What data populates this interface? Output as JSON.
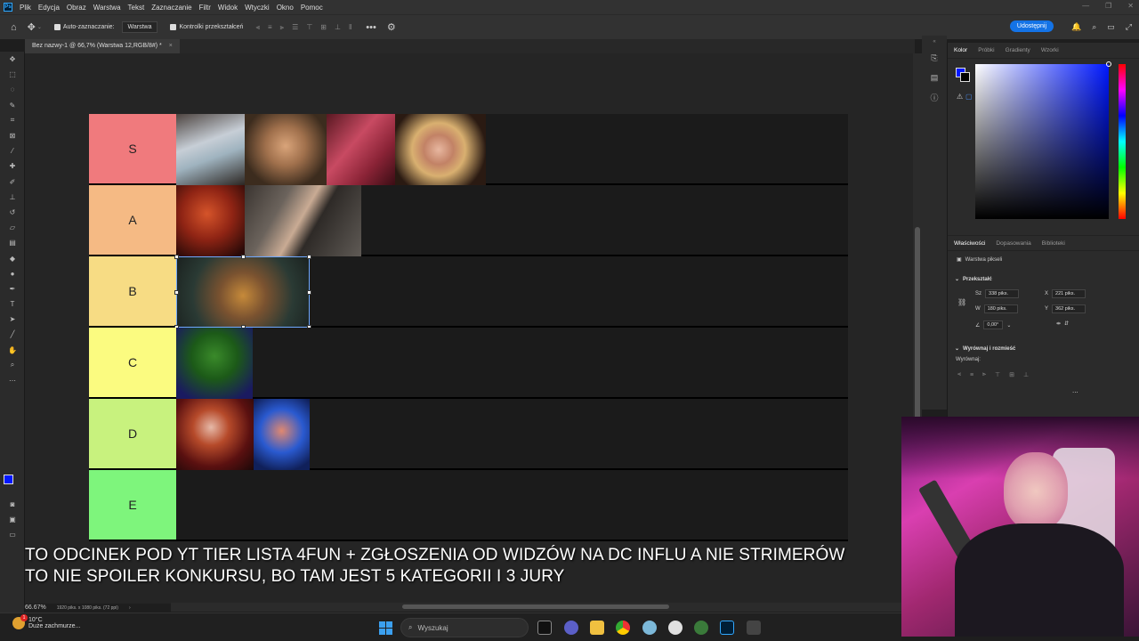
{
  "app": {
    "logo": "Ps"
  },
  "menu": [
    "Plik",
    "Edycja",
    "Obraz",
    "Warstwa",
    "Tekst",
    "Zaznaczanie",
    "Filtr",
    "Widok",
    "Wtyczki",
    "Okno",
    "Pomoc"
  ],
  "options": {
    "auto_select_label": "Auto-zaznaczanie:",
    "auto_select_value": "Warstwa",
    "transform_controls_label": "Kontrolki przekształceń",
    "share_label": "Udostępnij"
  },
  "doc_tab": {
    "title": "Bez nazwy-1 @ 66,7% (Warstwa 12,RGB/8#) *",
    "close": "×"
  },
  "tier_list": {
    "tiers": [
      {
        "label": "S",
        "color": "#f07a7d"
      },
      {
        "label": "A",
        "color": "#f5ba84"
      },
      {
        "label": "B",
        "color": "#f7dc84"
      },
      {
        "label": "C",
        "color": "#fbfb80"
      },
      {
        "label": "D",
        "color": "#c8f27e"
      },
      {
        "label": "E",
        "color": "#7ef57c"
      }
    ]
  },
  "status": {
    "zoom": "66.67%",
    "doc_size": "1920 piks. x 1080 piks. (72 ppi)",
    "arrow": "›"
  },
  "color_panel": {
    "tabs": [
      "Kolor",
      "Próbki",
      "Gradienty",
      "Wzorki"
    ],
    "foreground": "#0018ff",
    "background": "#000000"
  },
  "properties": {
    "tabs": [
      "Właściwości",
      "Dopasowania",
      "Biblioteki"
    ],
    "layer_type": "Warstwa pikseli",
    "transform_title": "Przekształć",
    "w_label": "Sz",
    "w_value": "338 piks.",
    "h_label": "W",
    "h_value": "180 piks.",
    "x_label": "X",
    "x_value": "221 piks.",
    "y_label": "Y",
    "y_value": "362 piks.",
    "angle_value": "0,00°",
    "align_title": "Wyrównaj i rozmieść",
    "align_label": "Wyrównaj:",
    "more": "..."
  },
  "subtitle": {
    "line1": "TO ODCINEK POD YT TIER LISTA 4FUN + ZGŁOSZENIA OD WIDZÓW NA DC INFLU A NIE STRIMERÓW",
    "line2": "TO NIE SPOILER KONKURSU, BO TAM JEST 5 KATEGORII I 3 JURY"
  },
  "taskbar": {
    "temp": "10°C",
    "weather": "Duże zachmurze...",
    "badge": "1",
    "search_placeholder": "Wyszukaj"
  }
}
